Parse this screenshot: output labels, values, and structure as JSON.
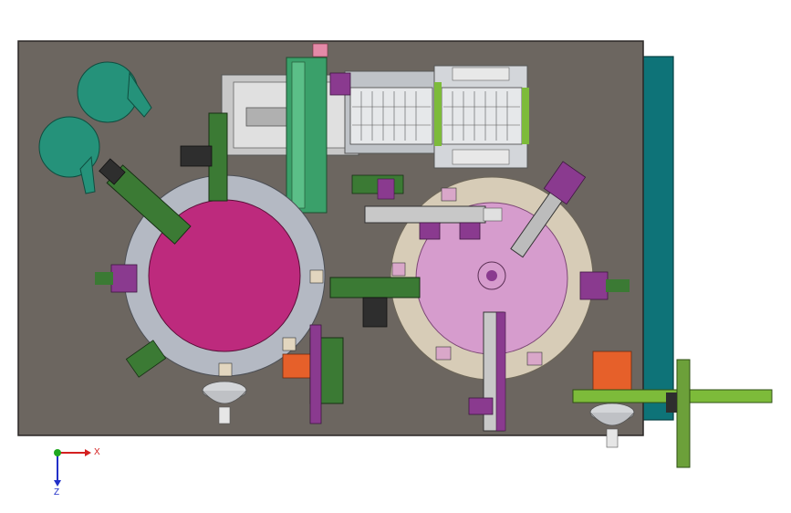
{
  "triad": {
    "x_label": "X",
    "z_label": "Z",
    "colors": {
      "x": "#d42020",
      "y": "#1fa81f",
      "z": "#2230c8"
    }
  },
  "colors": {
    "base_plate": "#6c6660",
    "side_frame": "#0e7378",
    "rotary_table_left": "#bd2a7d",
    "rotary_table_right": "#d69ccd",
    "ring_left": "#b4b9c3",
    "ring_right": "#d7ccb7",
    "feeder_bowl": "#25927a",
    "conveyor_green": "#7dbb3a",
    "frame_gray": "#c8c8c8",
    "module_green": "#3b7a34",
    "module_purple": "#8a3a8f",
    "orange_block": "#e6602a"
  }
}
